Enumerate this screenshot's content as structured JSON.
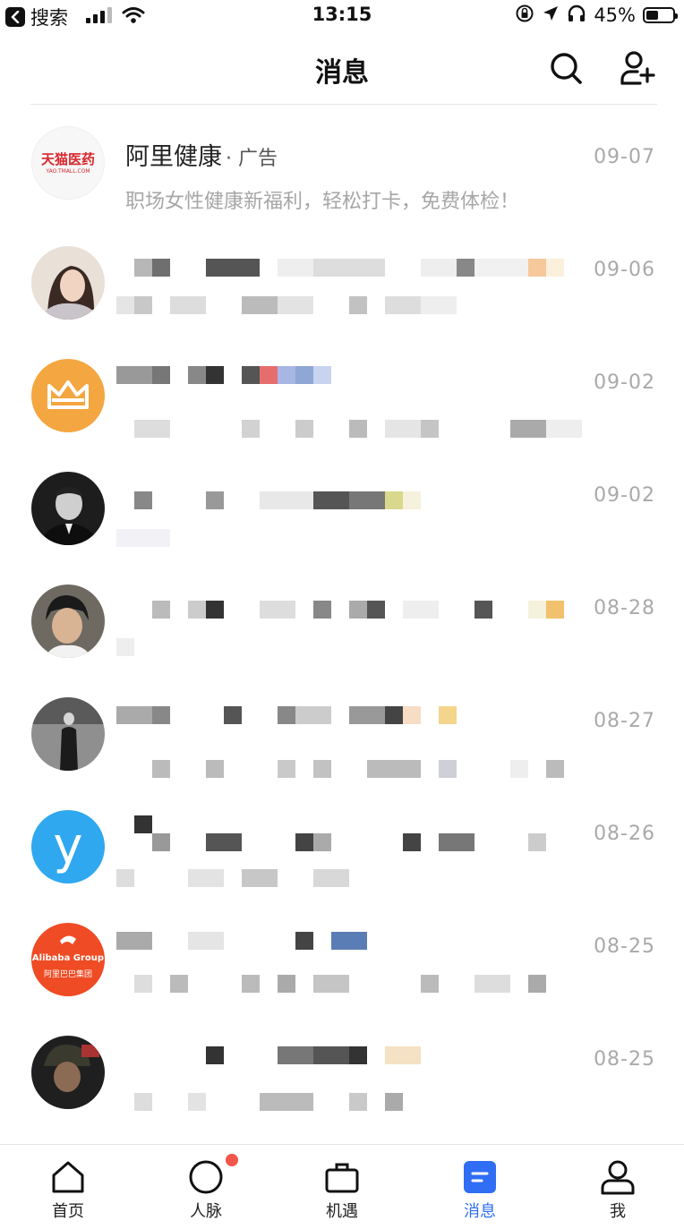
{
  "status_bar": {
    "back_label": "搜索",
    "time": "13:15",
    "battery": "45%",
    "battery_level": 0.45,
    "icons": [
      "signal-icon",
      "wifi-icon",
      "rotation-lock-icon",
      "location-icon",
      "headphones-icon",
      "battery-icon"
    ]
  },
  "header": {
    "title": "消息",
    "icons": [
      "search-icon",
      "add-contact-icon"
    ]
  },
  "messages": [
    {
      "name": "阿里健康",
      "tag": "· 广告",
      "preview": "职场女性健康新福利，轻松打卡，免费体检！",
      "date": "09-07",
      "avatar_logo": "天猫医药",
      "avatar_sub": "YAO.TMALL.COM"
    },
    {
      "date": "09-06"
    },
    {
      "date": "09-02"
    },
    {
      "date": "09-02"
    },
    {
      "date": "08-28"
    },
    {
      "date": "08-27"
    },
    {
      "date": "08-26",
      "avatar_letter": "y"
    },
    {
      "date": "08-25",
      "avatar_logo": "Alibaba Group",
      "avatar_sub": "阿里巴巴集团"
    },
    {
      "date": "08-25"
    }
  ],
  "tabs": [
    {
      "label": "首页"
    },
    {
      "label": "人脉"
    },
    {
      "label": "机遇"
    },
    {
      "label": "消息"
    },
    {
      "label": "我"
    }
  ],
  "colors": {
    "accent": "#2f6ef5",
    "badge": "#f0564a",
    "tmall_red": "#d9262b",
    "crown_orange": "#f4a640",
    "y_blue": "#2fa8f0",
    "alibaba_orange": "#ef4b24"
  }
}
